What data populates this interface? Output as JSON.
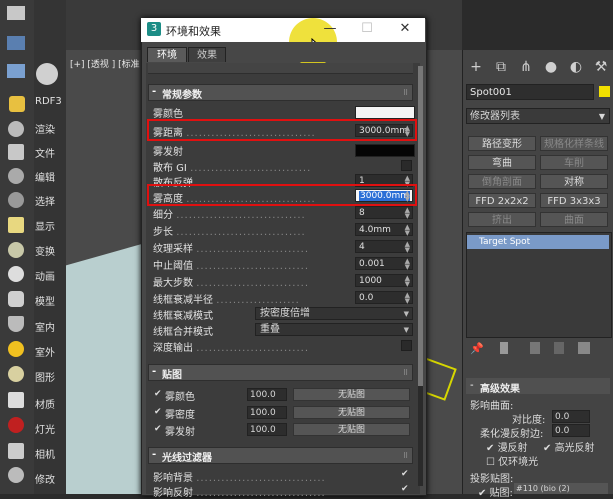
{
  "sidemenu": [
    "RDF3",
    "渲染",
    "文件",
    "编辑",
    "选择",
    "显示",
    "变换",
    "动画",
    "模型",
    "室内",
    "室外",
    "图形",
    "材质",
    "灯光",
    "相机",
    "修改"
  ],
  "viewport": {
    "label": "[+] [透视 ] [标准"
  },
  "dialog": {
    "title": "环境和效果",
    "logo": "3",
    "tabs": [
      "环境",
      "效果"
    ],
    "rollouts": {
      "general": {
        "sign": "-",
        "title": "常规参数"
      },
      "maps": {
        "sign": "-",
        "title": "贴图"
      },
      "filter": {
        "sign": "-",
        "title": "光线过滤器"
      }
    },
    "general_rows": [
      {
        "label": "雾颜色",
        "kind": "swatch",
        "color": "#f4f4f4"
      },
      {
        "label": "雾距离",
        "kind": "spinner",
        "value": "3000.0mm"
      },
      {
        "label": "雾发射",
        "kind": "swatch",
        "color": "#050505"
      },
      {
        "label": "散布 GI",
        "kind": "check"
      },
      {
        "label": "散布反弹",
        "kind": "spinner",
        "value": "1"
      },
      {
        "label": "雾高度",
        "kind": "spinner",
        "value": "3000.0mm",
        "selected": true
      },
      {
        "label": "细分",
        "kind": "spinner",
        "value": "8"
      },
      {
        "label": "步长",
        "kind": "spinner",
        "value": "4.0mm"
      },
      {
        "label": "纹理采样",
        "kind": "spinner",
        "value": "4"
      },
      {
        "label": "中止阈值",
        "kind": "spinner",
        "value": "0.001"
      },
      {
        "label": "最大步数",
        "kind": "spinner",
        "value": "1000"
      },
      {
        "label": "线框衰减半径",
        "kind": "spinner",
        "value": "0.0"
      },
      {
        "label": "线框衰减模式",
        "kind": "combo",
        "value": "按密度倍增"
      },
      {
        "label": "线框合并模式",
        "kind": "combo",
        "value": "重叠"
      },
      {
        "label": "深度输出",
        "kind": "check"
      }
    ],
    "map_rows": [
      {
        "check": "✔",
        "label": "雾颜色",
        "value": "100.0",
        "button": "无贴图"
      },
      {
        "check": "✔",
        "label": "雾密度",
        "value": "100.0",
        "button": "无贴图"
      },
      {
        "check": "✔",
        "label": "雾发射",
        "value": "100.0",
        "button": "无贴图"
      }
    ],
    "filter_rows": [
      {
        "label": "影响背景",
        "check": "✔"
      },
      {
        "label": "影响反射",
        "check": "✔"
      }
    ]
  },
  "rightpanel": {
    "object_name": "Spot001",
    "object_color": "#f2e000",
    "modifier_list": "修改器列表",
    "mod_buttons": [
      {
        "label": "路径变形",
        "dim": false
      },
      {
        "label": "规格化样条线",
        "dim": true
      },
      {
        "label": "弯曲",
        "dim": false
      },
      {
        "label": "车削",
        "dim": true
      },
      {
        "label": "倒角剖面",
        "dim": true
      },
      {
        "label": "对称",
        "dim": false
      },
      {
        "label": "FFD 2x2x2",
        "dim": false
      },
      {
        "label": "FFD 3x3x3",
        "dim": false
      },
      {
        "label": "挤出",
        "dim": true
      },
      {
        "label": "曲面",
        "dim": true
      }
    ],
    "stack_item": "Target Spot",
    "advanced": {
      "title": "高级效果",
      "affect_surface": "影响曲面:",
      "contrast_label": "对比度:",
      "contrast_value": "0.0",
      "soften_label": "柔化漫反射边:",
      "soften_value": "0.0",
      "diffuse": "漫反射",
      "specular": "高光反射",
      "ambient_only": "仅环境光",
      "projector": "投影贴图:",
      "map_label": "贴图:",
      "map_value": "#110 (bio (2)"
    }
  }
}
